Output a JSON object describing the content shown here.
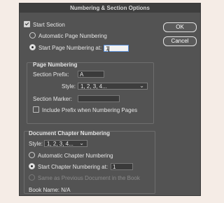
{
  "dialog": {
    "title": "Numbering & Section Options"
  },
  "section": {
    "start_section_label": "Start Section",
    "auto_page_label": "Automatic Page Numbering",
    "start_page_label": "Start Page Numbering at:",
    "start_page_value": "1"
  },
  "buttons": {
    "ok": "OK",
    "cancel": "Cancel"
  },
  "page_numbering": {
    "heading": "Page Numbering",
    "prefix_label": "Section Prefix:",
    "prefix_value": "A",
    "style_label": "Style:",
    "style_value": "1, 2, 3, 4...",
    "marker_label": "Section Marker:",
    "marker_value": "",
    "include_prefix_label": "Include Prefix when Numbering Pages"
  },
  "chapter": {
    "heading": "Document Chapter Numbering",
    "style_label": "Style:",
    "style_value": "1, 2, 3, 4...",
    "auto_label": "Automatic Chapter Numbering",
    "start_label": "Start Chapter Numbering at:",
    "start_value": "1",
    "same_as_prev_label": "Same as Previous Document in the Book",
    "book_name": "Book Name: N/A"
  }
}
